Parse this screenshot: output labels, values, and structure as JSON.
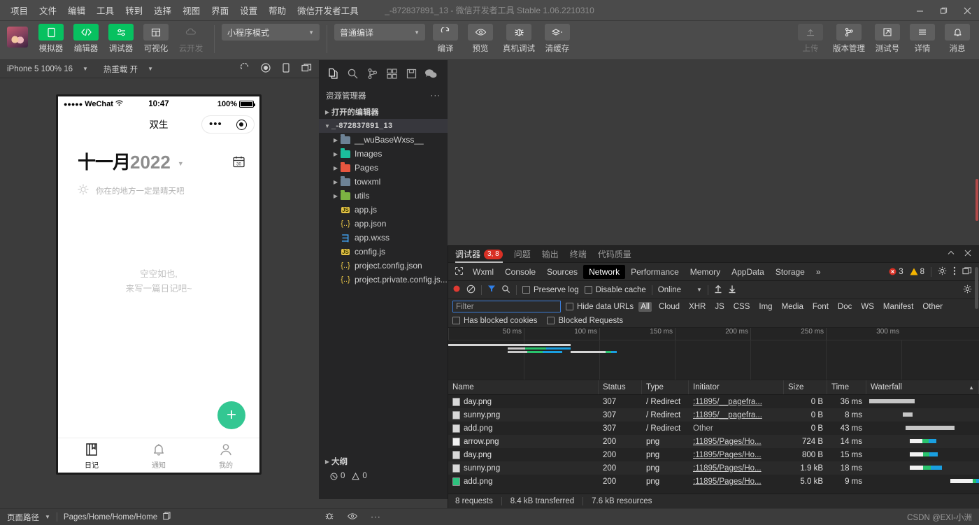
{
  "window": {
    "title": "_-872837891_13 - 微信开发者工具 Stable 1.06.2210310",
    "menus": [
      "项目",
      "文件",
      "编辑",
      "工具",
      "转到",
      "选择",
      "视图",
      "界面",
      "设置",
      "帮助",
      "微信开发者工具"
    ],
    "controls": {
      "minimize": "minimize-icon",
      "maximize": "restore-icon",
      "close": "close-icon"
    }
  },
  "toolbar": {
    "left_items": [
      {
        "label": "模拟器",
        "icon": "phone-icon",
        "state": "active"
      },
      {
        "label": "编辑器",
        "icon": "code-icon",
        "state": "active"
      },
      {
        "label": "调试器",
        "icon": "sliders-icon",
        "state": "active"
      },
      {
        "label": "可视化",
        "icon": "layout-icon",
        "state": "grey"
      },
      {
        "label": "云开发",
        "icon": "cloud-icon",
        "state": "disabled"
      }
    ],
    "mode_select": "小程序模式",
    "compile_select": "普通编译",
    "actions": [
      {
        "label": "编译",
        "icon": "refresh-icon"
      },
      {
        "label": "预览",
        "icon": "eye-icon"
      },
      {
        "label": "真机调试",
        "icon": "bug-icon"
      },
      {
        "label": "清缓存",
        "icon": "layers-icon"
      }
    ],
    "right_items": [
      {
        "label": "上传",
        "icon": "upload-icon",
        "state": "disabled"
      },
      {
        "label": "版本管理",
        "icon": "git-branch-icon",
        "state": "normal"
      },
      {
        "label": "测试号",
        "icon": "external-link-icon",
        "state": "normal"
      },
      {
        "label": "详情",
        "icon": "menu-icon",
        "state": "normal"
      },
      {
        "label": "消息",
        "icon": "bell-icon",
        "state": "normal"
      }
    ]
  },
  "simulator_bar": {
    "device": "iPhone 5 100% 16",
    "hot_reload": "热重载 开",
    "icons": [
      "rotate-icon",
      "record-icon",
      "device-icon",
      "multi-window-icon"
    ]
  },
  "phone": {
    "status": {
      "carrier": "WeChat",
      "time": "10:47",
      "battery_pct": "100%"
    },
    "nav_title": "双生",
    "month_cn": "十一月",
    "month_year": "2022",
    "weather_text": "你在的地方一定是晴天吧",
    "empty_line1": "空空如也,",
    "empty_line2": "来写一篇日记吧~",
    "fab_label": "+",
    "tabs": [
      {
        "label": "日记",
        "icon": "book-icon",
        "active": true
      },
      {
        "label": "通知",
        "icon": "bell-icon",
        "active": false
      },
      {
        "label": "我的",
        "icon": "user-icon",
        "active": false
      }
    ]
  },
  "explorer": {
    "activity_icons": [
      "files-icon",
      "search-icon",
      "source-control-icon",
      "extensions-icon",
      "save-icon",
      "wechat-icon"
    ],
    "title": "资源管理器",
    "more": "···",
    "sections": [
      {
        "label": "打开的编辑器",
        "expanded": false
      },
      {
        "label": "_-872837891_13",
        "expanded": true
      }
    ],
    "files": [
      {
        "name": "__wuBaseWxss__",
        "type": "folder",
        "color": "#6d8295",
        "indent": 2
      },
      {
        "name": "Images",
        "type": "folder",
        "color": "#1bbf9c",
        "indent": 2
      },
      {
        "name": "Pages",
        "type": "folder",
        "color": "#e8563f",
        "indent": 2
      },
      {
        "name": "towxml",
        "type": "folder",
        "color": "#6d8295",
        "indent": 2
      },
      {
        "name": "utils",
        "type": "folder",
        "color": "#7cb342",
        "indent": 2
      },
      {
        "name": "app.js",
        "type": "js",
        "color": "#e8c547",
        "indent": 3
      },
      {
        "name": "app.json",
        "type": "json",
        "color": "#e8c547",
        "indent": 3
      },
      {
        "name": "app.wxss",
        "type": "wxss",
        "color": "#42a5f5",
        "indent": 3
      },
      {
        "name": "config.js",
        "type": "js",
        "color": "#e8c547",
        "indent": 3
      },
      {
        "name": "project.config.json",
        "type": "json",
        "color": "#e8c547",
        "indent": 3
      },
      {
        "name": "project.private.config.js...",
        "type": "json",
        "color": "#e8c547",
        "indent": 3
      }
    ],
    "outline_label": "大纲",
    "problems": {
      "errors": "0",
      "warnings": "0"
    }
  },
  "devtools": {
    "panel_tabs": [
      {
        "label": "调试器",
        "badge": "3, 8",
        "active": true
      },
      {
        "label": "问题",
        "badge": "",
        "active": false
      },
      {
        "label": "输出",
        "badge": "",
        "active": false
      },
      {
        "label": "终端",
        "badge": "",
        "active": false
      },
      {
        "label": "代码质量",
        "badge": "",
        "active": false
      }
    ],
    "panel_controls": [
      "collapse-icon",
      "close-icon"
    ],
    "tabs": [
      "Wxml",
      "Console",
      "Sources",
      "Network",
      "Performance",
      "Memory",
      "AppData",
      "Storage"
    ],
    "active_tab": "Network",
    "overflow": "»",
    "error_count": "3",
    "warning_count": "8",
    "network": {
      "record_icon": "record-icon",
      "clear_icon": "clear-icon",
      "filter_icon": "filter-icon",
      "search_icon": "search-icon",
      "preserve_log": "Preserve log",
      "disable_cache": "Disable cache",
      "throttling": "Online",
      "filter_placeholder": "Filter",
      "hide_data_urls": "Hide data URLs",
      "types": [
        "All",
        "Cloud",
        "XHR",
        "JS",
        "CSS",
        "Img",
        "Media",
        "Font",
        "Doc",
        "WS",
        "Manifest",
        "Other"
      ],
      "active_type": "All",
      "has_blocked_cookies": "Has blocked cookies",
      "blocked_requests": "Blocked Requests",
      "timeline_ticks": [
        "50 ms",
        "100 ms",
        "150 ms",
        "200 ms",
        "250 ms",
        "300 ms"
      ],
      "columns": [
        "Name",
        "Status",
        "Type",
        "Initiator",
        "Size",
        "Time",
        "Waterfall"
      ],
      "rows": [
        {
          "name": "day.png",
          "status": "307",
          "type": "/ Redirect",
          "initiator": ":11895/__pagefra...",
          "initiator_link": true,
          "size": "0 B",
          "time": "36 ms",
          "wf_start": 2,
          "wf_wait": 28,
          "wf_dl": 0
        },
        {
          "name": "sunny.png",
          "status": "307",
          "type": "/ Redirect",
          "initiator": ":11895/__pagefra...",
          "initiator_link": true,
          "size": "0 B",
          "time": "8 ms",
          "wf_start": 32,
          "wf_wait": 8,
          "wf_dl": 0
        },
        {
          "name": "add.png",
          "status": "307",
          "type": "/ Redirect",
          "initiator": "Other",
          "initiator_link": false,
          "size": "0 B",
          "time": "43 ms",
          "wf_start": 34,
          "wf_wait": 40,
          "wf_dl": 0
        },
        {
          "name": "arrow.png",
          "status": "200",
          "type": "png",
          "initiator": ":11895/Pages/Ho...",
          "initiator_link": true,
          "size": "724 B",
          "time": "14 ms",
          "wf_start": 38,
          "wf_wait": 10,
          "wf_dl": 10
        },
        {
          "name": "day.png",
          "status": "200",
          "type": "png",
          "initiator": ":11895/Pages/Ho...",
          "initiator_link": true,
          "size": "800 B",
          "time": "15 ms",
          "wf_start": 38,
          "wf_wait": 11,
          "wf_dl": 11
        },
        {
          "name": "sunny.png",
          "status": "200",
          "type": "png",
          "initiator": ":11895/Pages/Ho...",
          "initiator_link": true,
          "size": "1.9 kB",
          "time": "18 ms",
          "wf_start": 38,
          "wf_wait": 11,
          "wf_dl": 15
        },
        {
          "name": "add.png",
          "status": "200",
          "type": "png",
          "initiator": ":11895/Pages/Ho...",
          "initiator_link": true,
          "size": "5.0 kB",
          "time": "9 ms",
          "wf_start": 78,
          "wf_wait": 20,
          "wf_dl": 5
        }
      ],
      "summary": {
        "requests": "8 requests",
        "transferred": "8.4 kB transferred",
        "resources": "7.6 kB resources"
      }
    }
  },
  "status_bar": {
    "page_path_label": "页面路径",
    "page_path": "Pages/Home/Home/Home",
    "copy_icon": "copy-icon",
    "icons": [
      "bug-icon",
      "eye-icon",
      "more-icon"
    ],
    "watermark": "CSDN @EXI-小洲"
  },
  "colors": {
    "wechat_green": "#07c160",
    "fab_green": "#33c792",
    "accent_blue": "#3b7dd8",
    "error_red": "#d93025",
    "warning_yellow": "#f4b400"
  }
}
